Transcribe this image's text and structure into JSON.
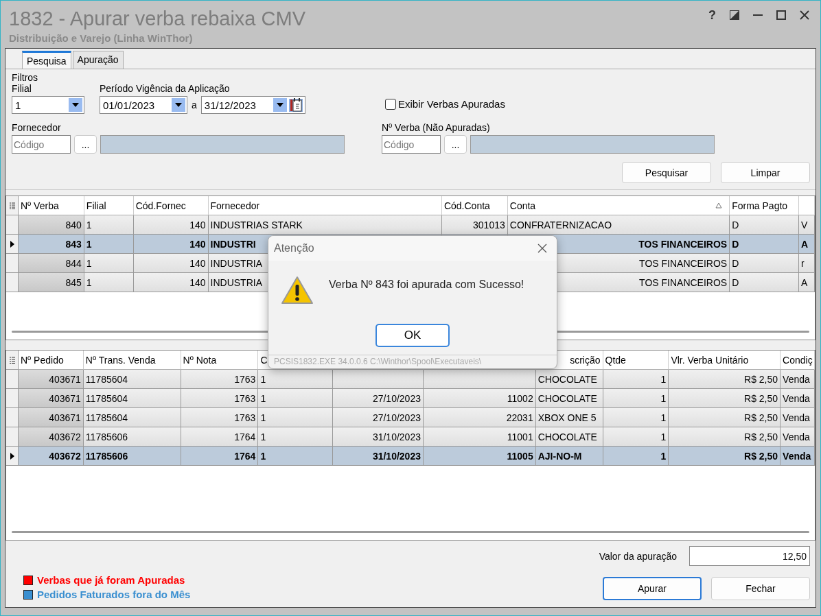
{
  "window": {
    "title": "1832 - Apurar verba rebaixa CMV",
    "subtitle": "Distribuição e Varejo (Linha WinThor)",
    "help": "?"
  },
  "tabs": [
    {
      "label": "Pesquisa",
      "selected": true
    },
    {
      "label": "Apuração",
      "selected": false
    }
  ],
  "filters": {
    "title": "Filtros",
    "filial": {
      "label": "Filial",
      "value": "1"
    },
    "periodo": {
      "label": "Período Vigência da Aplicação",
      "from": "01/01/2023",
      "separator": "a",
      "to": "31/12/2023"
    },
    "show_apuradas": {
      "label": "Exibir Verbas Apuradas",
      "checked": false
    },
    "fornecedor": {
      "label": "Fornecedor",
      "placeholder": "Código",
      "lookup": "..."
    },
    "verba": {
      "label": "Nº Verba (Não Apuradas)",
      "placeholder": "Código",
      "lookup": "..."
    },
    "buttons": [
      "Pesquisar",
      "Limpar"
    ]
  },
  "verbas_grid": {
    "columns": [
      {
        "label": "Nº Verba",
        "sorted": false
      },
      {
        "label": "Filial",
        "sorted": false
      },
      {
        "label": "Cód.Fornec",
        "sorted": false
      },
      {
        "label": "Fornecedor",
        "sorted": false
      },
      {
        "label": "Cód.Conta",
        "sorted": false
      },
      {
        "label": "Conta",
        "sorted": true
      },
      {
        "label": "Forma Pagto",
        "sorted": false
      },
      {
        "sorted": false
      }
    ],
    "rows": [
      {
        "selected": false,
        "cells": [
          "840",
          "1",
          "140",
          "INDUSTRIAS STARK",
          "301013",
          "CONFRATERNIZACAO",
          "D",
          "V"
        ]
      },
      {
        "selected": true,
        "cells": [
          "843",
          "1",
          "140",
          "INDUSTRI",
          null,
          {
            "text": "TOS FINANCEIROS",
            "cut": true
          },
          "D",
          "A"
        ]
      },
      {
        "selected": false,
        "cells": [
          "844",
          "1",
          "140",
          "INDUSTRIA",
          null,
          {
            "text": "TOS FINANCEIROS",
            "cut": true
          },
          "D",
          "r"
        ]
      },
      {
        "selected": false,
        "cells": [
          "845",
          "1",
          "140",
          "INDUSTRIA",
          null,
          {
            "text": "TOS FINANCEIROS",
            "cut": true
          },
          "D",
          "A"
        ]
      }
    ]
  },
  "pedidos_grid": {
    "columns": [
      {
        "label": "Nº Pedido"
      },
      {
        "label": "Nº Trans. Venda"
      },
      {
        "label": "Nº Nota"
      },
      {
        "label": "C"
      },
      {},
      {},
      {
        "label": "scrição",
        "cut": true
      },
      {
        "label": "Qtde"
      },
      {
        "label": "Vlr. Verba Unitário"
      },
      {
        "label": "Condiç"
      }
    ],
    "rows": [
      {
        "selected": false,
        "cells": [
          "403671",
          "11785604",
          "1763",
          "1",
          null,
          null,
          "CHOCOLATE",
          "1",
          "R$ 2,50",
          "Venda"
        ]
      },
      {
        "selected": false,
        "cells": [
          "403671",
          "11785604",
          "1763",
          "1",
          "27/10/2023",
          "11002",
          "CHOCOLATE",
          "1",
          "R$ 2,50",
          "Venda"
        ]
      },
      {
        "selected": false,
        "cells": [
          "403671",
          "11785604",
          "1763",
          "1",
          "27/10/2023",
          "22031",
          "XBOX ONE 5",
          "1",
          "R$ 2,50",
          "Venda"
        ]
      },
      {
        "selected": false,
        "cells": [
          "403672",
          "11785606",
          "1764",
          "1",
          "31/10/2023",
          "11001",
          "CHOCOLATE",
          "1",
          "R$ 2,50",
          "Venda"
        ]
      },
      {
        "selected": true,
        "cells": [
          "403672",
          "11785606",
          "1764",
          "1",
          "31/10/2023",
          "11005",
          "AJI-NO-M",
          "1",
          "R$ 2,50",
          "Venda"
        ]
      }
    ]
  },
  "footer": {
    "valor": {
      "label": "Valor da apuração",
      "value": "12,50"
    },
    "legend": [
      {
        "label": "Verbas que já foram Apuradas",
        "color": "#ff0000"
      },
      {
        "label": "Pedidos Faturados fora do Mês",
        "color": "#3a8fd0"
      }
    ],
    "buttons": [
      {
        "label": "Apurar",
        "default": true
      },
      {
        "label": "Fechar",
        "default": false
      }
    ]
  },
  "dialog": {
    "title": "Atenção",
    "message": "Verba Nº 843 foi apurada com Sucesso!",
    "button": "OK",
    "footer": "PCSIS1832.EXE 34.0.0.6 C:\\Winthor\\Spool\\Executaveis\\"
  }
}
